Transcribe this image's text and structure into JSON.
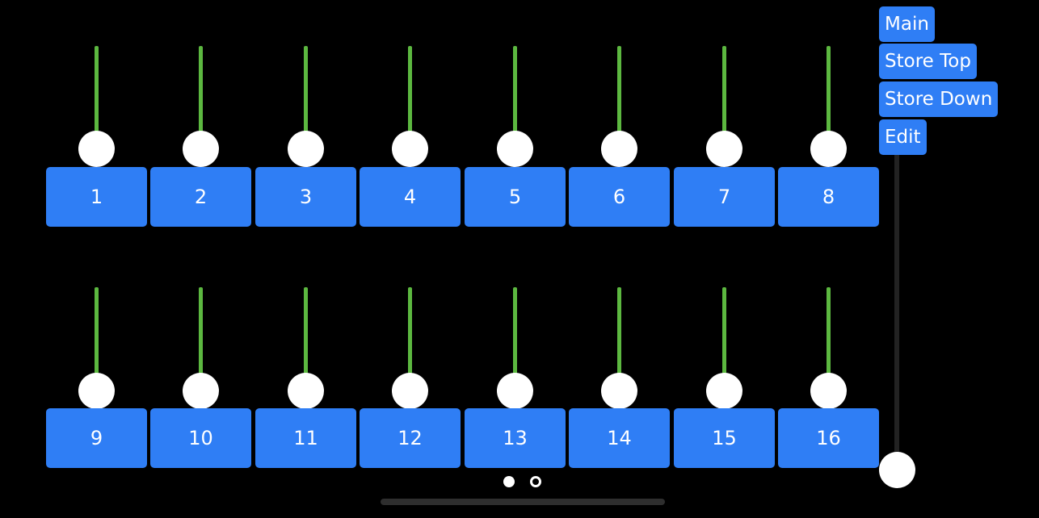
{
  "channels": [
    "1",
    "2",
    "3",
    "4",
    "5",
    "6",
    "7",
    "8",
    "9",
    "10",
    "11",
    "12",
    "13",
    "14",
    "15",
    "16"
  ],
  "menu": {
    "main": "Main",
    "store_top": "Store Top",
    "store_down": "Store Down",
    "edit": "Edit"
  },
  "pager": {
    "pages": 2,
    "current": 1
  },
  "colors": {
    "accent": "#2f7ef5",
    "fader_track": "#5cb840",
    "knob": "#ffffff",
    "background": "#000000"
  }
}
